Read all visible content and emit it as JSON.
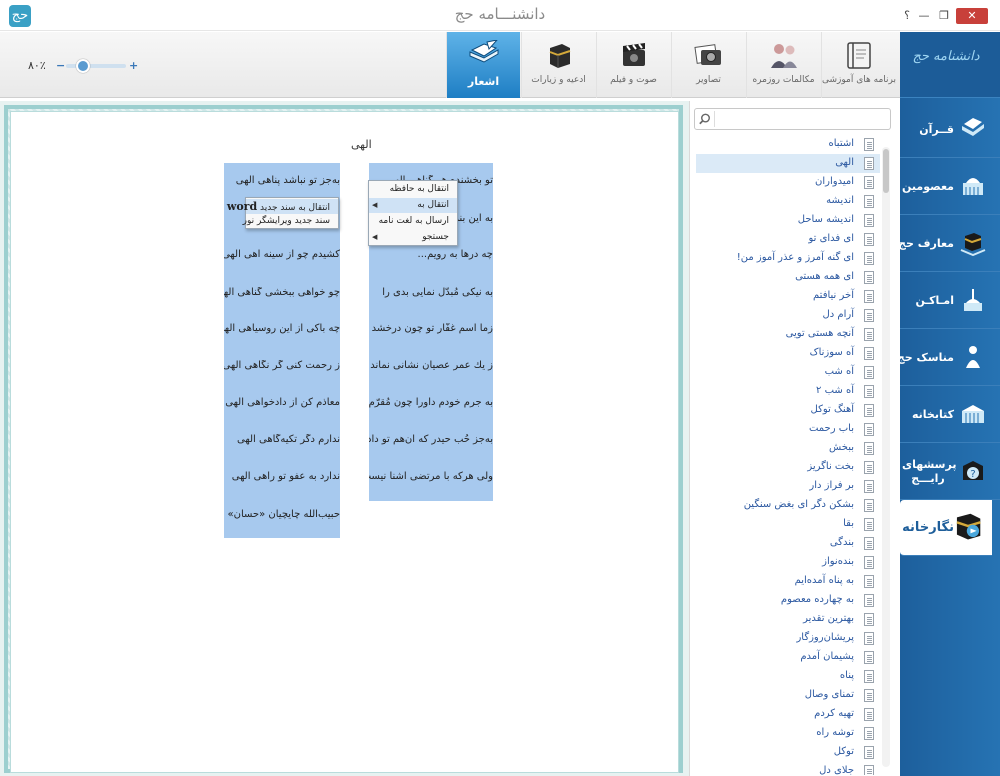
{
  "window": {
    "title": "دانشنـــامه حج",
    "logo_glyph": "حج",
    "help": "؟",
    "minimize": "—",
    "maximize": "❐",
    "close": "✕"
  },
  "toolbar": {
    "zoom": {
      "label": "۸۰٪",
      "minus": "−",
      "plus": "+",
      "level_percent": 80
    },
    "tabs": [
      {
        "id": "poems",
        "label": "اشعار",
        "icon": "book-quill-icon",
        "active": true
      },
      {
        "id": "prayers",
        "label": "ادعیه و زیارات",
        "icon": "kaaba-icon",
        "active": false
      },
      {
        "id": "media",
        "label": "صوت و فیلم",
        "icon": "film-clapper-icon",
        "active": false
      },
      {
        "id": "images",
        "label": "تصاویر",
        "icon": "camera-photos-icon",
        "active": false
      },
      {
        "id": "dialogs",
        "label": "مکالمات روزمره",
        "icon": "people-talking-icon",
        "active": false
      },
      {
        "id": "tutorial",
        "label": "برنامه های آموزشی",
        "icon": "notebook-icon",
        "active": false
      }
    ]
  },
  "sidebar": {
    "brand": "دانشنامه حج",
    "items": [
      {
        "id": "quran",
        "label": "قــرآن",
        "icon": "quran-icon",
        "active": false
      },
      {
        "id": "masumin",
        "label": "معصومین",
        "icon": "shrine-icon",
        "active": false
      },
      {
        "id": "maaref",
        "label": "معارف حج",
        "icon": "kaaba-book-icon",
        "active": false
      },
      {
        "id": "amaken",
        "label": "امـاكـن",
        "icon": "mosque-icon",
        "active": false
      },
      {
        "id": "manasek",
        "label": "مناسک حج",
        "icon": "pilgrim-icon",
        "active": false
      },
      {
        "id": "library",
        "label": "کتابخانه",
        "icon": "library-icon",
        "active": false
      },
      {
        "id": "faq",
        "label": "پرسشهای رایـــج",
        "icon": "question-icon",
        "active": false
      },
      {
        "id": "gallery",
        "label": "نگارخانه",
        "icon": "gallery-icon",
        "active": true
      }
    ]
  },
  "search": {
    "value": "",
    "placeholder": ""
  },
  "poem_list": [
    {
      "label": "اشتباه",
      "selected": false
    },
    {
      "label": "الهی",
      "selected": true
    },
    {
      "label": "امیدواران",
      "selected": false
    },
    {
      "label": "اندیشه",
      "selected": false
    },
    {
      "label": "اندیشه ساحل",
      "selected": false
    },
    {
      "label": "ای فدای تو",
      "selected": false
    },
    {
      "label": "ای گنه آمرز و عذر آموز من!",
      "selected": false
    },
    {
      "label": "ای همه هستی",
      "selected": false
    },
    {
      "label": "آخر نیافتم",
      "selected": false
    },
    {
      "label": "آرام دل",
      "selected": false
    },
    {
      "label": "آنچه هستی تویی",
      "selected": false
    },
    {
      "label": "آه سوزناک",
      "selected": false
    },
    {
      "label": "آه شب",
      "selected": false
    },
    {
      "label": "آه شب ۲",
      "selected": false
    },
    {
      "label": "آهنگ توکل",
      "selected": false
    },
    {
      "label": "باب رحمت",
      "selected": false
    },
    {
      "label": "ببخش",
      "selected": false
    },
    {
      "label": "بخت ناگریز",
      "selected": false
    },
    {
      "label": "بر فراز دار",
      "selected": false
    },
    {
      "label": "بشکن دگر ای بغض سنگین",
      "selected": false
    },
    {
      "label": "بقا",
      "selected": false
    },
    {
      "label": "بندگی",
      "selected": false
    },
    {
      "label": "بنده‌نواز",
      "selected": false
    },
    {
      "label": "به پناه آمده‌ایم",
      "selected": false
    },
    {
      "label": "به چهارده معصوم",
      "selected": false
    },
    {
      "label": "بهترین تقدیر",
      "selected": false
    },
    {
      "label": "پریشان‌روزگار",
      "selected": false
    },
    {
      "label": "پشیمان آمدم",
      "selected": false
    },
    {
      "label": "پناه",
      "selected": false
    },
    {
      "label": "تمنای وصال",
      "selected": false
    },
    {
      "label": "تهیه کردم",
      "selected": false
    },
    {
      "label": "توشه راه",
      "selected": false
    },
    {
      "label": "توکل",
      "selected": false
    },
    {
      "label": "جلای دل",
      "selected": false
    }
  ],
  "poem": {
    "title": "الهی",
    "right_column": [
      "تو بخشنده هر گناهی الهی",
      "به این بنده...",
      "چه درها به رویم...",
      "به نیکی مُبدّل نمایی بدی را",
      "زما اسم غفّار تو چون درخشد",
      "ز یك عمر عصیان نشانی نماند",
      "به جرم خودم داورا چون مُقرّم",
      "به‌جز حُب حیدر که آن‌هم تو دادی",
      "ولی هرکه با مرتضی آشنا نیست"
    ],
    "left_column": [
      "به‌جز تو نباشد پناهی الهی",
      "",
      "",
      "کشیدم چو از سینه آهی الهی",
      "چو خواهی ببخشی گناهی الهی",
      "چه باکی از این روسیاهی الهی",
      "ز رحمت کنی گر نگاهی الهی",
      "معاذم کن از دادخواهی الهی",
      "ندارم دگر تکیه‌گاهی الهی",
      "ندارد به عفو تو راهی الهی",
      "حبیب‌الله چایچیان «حسان»"
    ]
  },
  "context_menu": {
    "items": [
      {
        "label": "انتقال به حافظه",
        "has_submenu": false,
        "highlighted": false
      },
      {
        "label": "انتقال به",
        "has_submenu": true,
        "highlighted": true
      },
      {
        "label": "ارسال به لغت نامه",
        "has_submenu": false,
        "highlighted": false
      },
      {
        "label": "جستجو",
        "has_submenu": true,
        "highlighted": false
      }
    ],
    "arrow": "◀"
  },
  "submenu": {
    "items": [
      {
        "label_prefix": "انتقال به سند جدید",
        "label_word": "word",
        "highlighted": true
      },
      {
        "label": "سند جدید ویرایشگر نور",
        "highlighted": false
      }
    ]
  },
  "colors": {
    "sidebar_blue": "#2673b3",
    "active_tab_blue": "#1e7ec4",
    "selection_blue": "#a7c9ee",
    "frame_teal": "#9ccfcf",
    "close_red": "#c8403a"
  }
}
